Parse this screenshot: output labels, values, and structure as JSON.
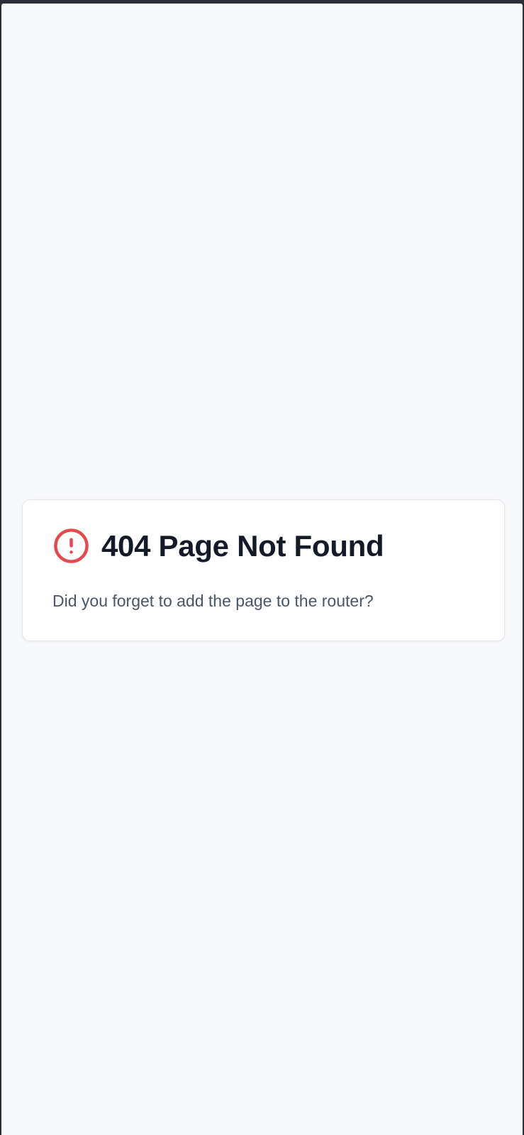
{
  "not_found": {
    "title": "404 Page Not Found",
    "message": "Did you forget to add the page to the router?",
    "icon": "alert-circle-icon"
  },
  "colors": {
    "page_background": "#f8f9fb",
    "card_background": "#ffffff",
    "title_text": "#151a28",
    "message_text": "#4b5563",
    "error_icon": "#e5484d"
  }
}
